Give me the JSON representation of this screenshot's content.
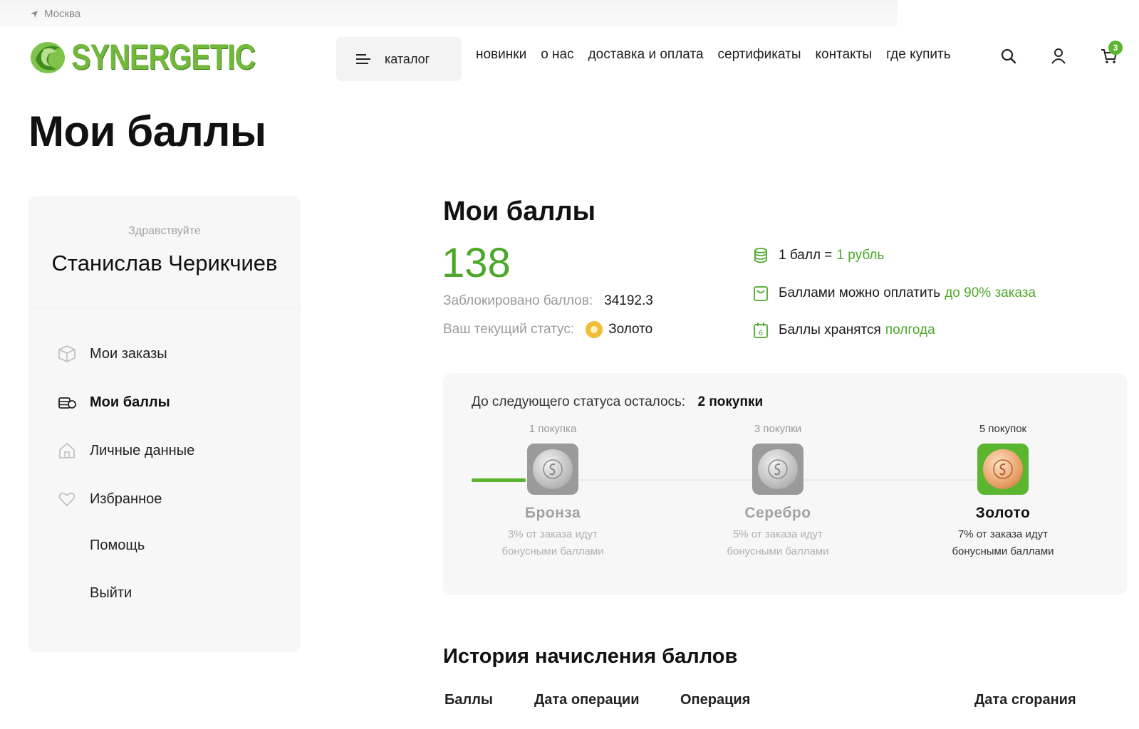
{
  "header": {
    "city": "Москва",
    "logo_text": "SYNERGETIC",
    "catalog_label": "каталог",
    "nav": [
      "новинки",
      "о нас",
      "доставка и оплата",
      "сертификаты",
      "контакты",
      "где купить"
    ],
    "cart_count": "3"
  },
  "page": {
    "title": "Мои баллы"
  },
  "sidebar": {
    "greeting": "Здравствуйте",
    "user_name": "Станислав Черикчиев",
    "items": [
      {
        "label": "Мои заказы",
        "icon": "box-icon",
        "active": false
      },
      {
        "label": "Мои баллы",
        "icon": "coins-icon",
        "active": true
      },
      {
        "label": "Личные данные",
        "icon": "home-icon",
        "active": false
      },
      {
        "label": "Избранное",
        "icon": "heart-icon",
        "active": false
      },
      {
        "label": "Помощь",
        "icon": "",
        "active": false
      },
      {
        "label": "Выйти",
        "icon": "",
        "active": false
      }
    ]
  },
  "points": {
    "title": "Мои баллы",
    "balance": "138",
    "blocked_label": "Заблокировано баллов:",
    "blocked_value": "34192.3",
    "status_label": "Ваш текущий статус:",
    "status_value": "Золото"
  },
  "info": [
    {
      "icon": "database-icon",
      "text": "1 балл =",
      "highlight": "1 рубль"
    },
    {
      "icon": "wallet-icon",
      "text": "Баллами можно оплатить",
      "highlight": "до 90% заказа"
    },
    {
      "icon": "calendar-icon",
      "text": "Баллы хранятся",
      "highlight": "полгода"
    }
  ],
  "status_card": {
    "next_label": "До следующего статуса осталось:",
    "next_value": "2 покупки",
    "progress": 0.1,
    "levels": [
      {
        "req": "1 покупка",
        "name": "Бронза",
        "desc1": "3% от заказа идут",
        "desc2": "бонусными баллами",
        "current": false
      },
      {
        "req": "3 покупки",
        "name": "Серебро",
        "desc1": "5% от заказа идут",
        "desc2": "бонусными баллами",
        "current": false
      },
      {
        "req": "5 покупок",
        "name": "Золото",
        "desc1": "7% от заказа идут",
        "desc2": "бонусными баллами",
        "current": true
      }
    ]
  },
  "history": {
    "title": "История начисления баллов",
    "columns": [
      "Баллы",
      "Дата операции",
      "Операция",
      "Дата сгорания"
    ]
  },
  "colors": {
    "accent": "#4ca82a",
    "gold": "#f1bd36",
    "panel": "#f7f7f7"
  }
}
